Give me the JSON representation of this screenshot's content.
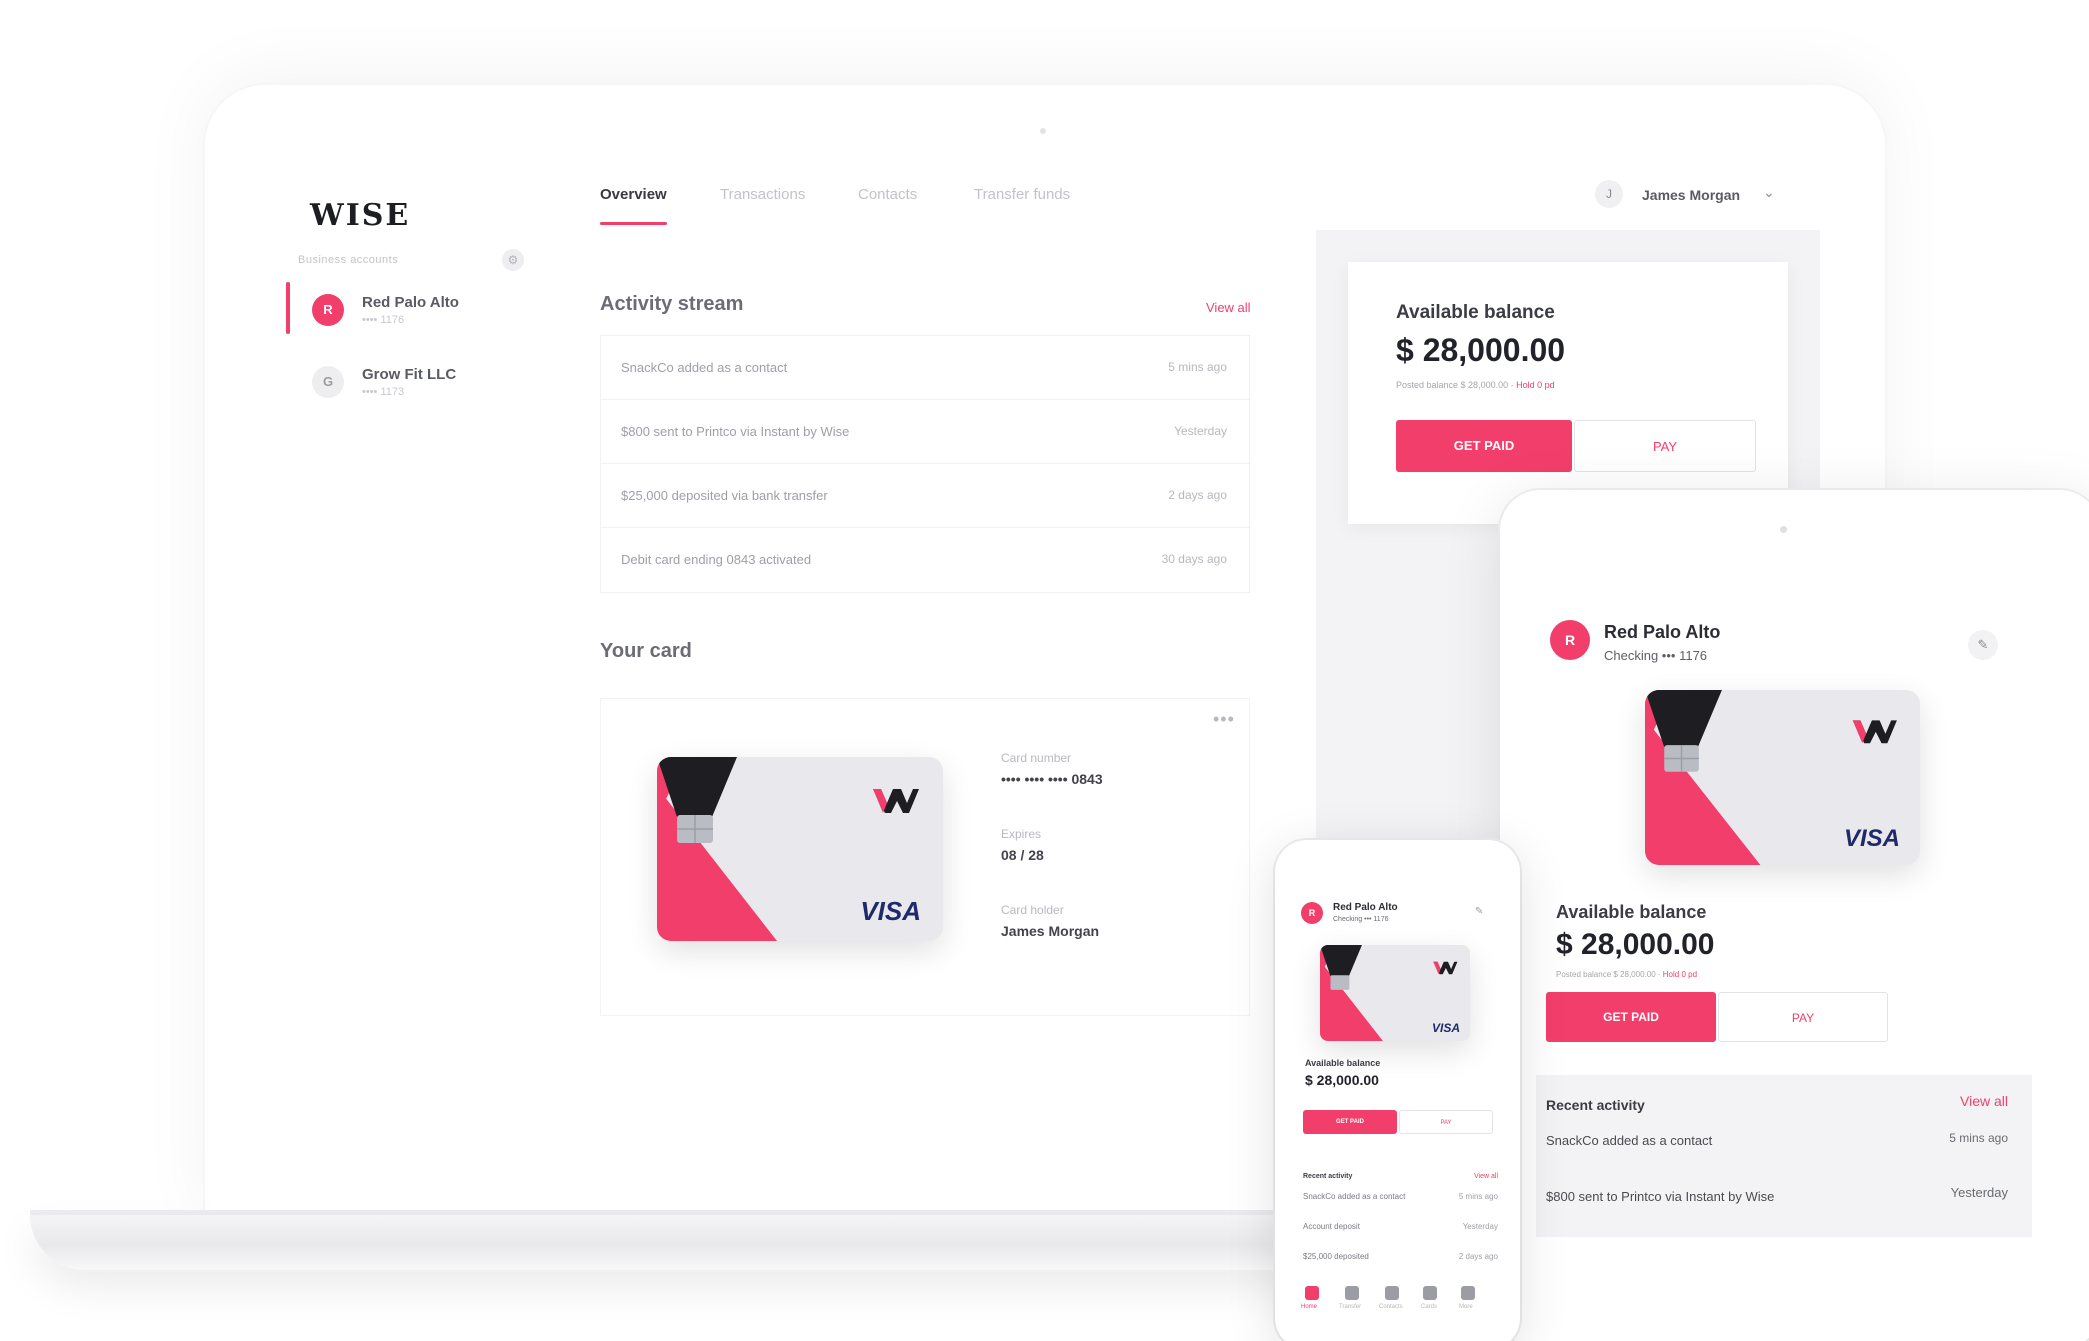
{
  "app": {
    "logo": "WISE"
  },
  "sidebar": {
    "section_label": "Business accounts",
    "accounts": [
      {
        "initial": "R",
        "name": "Red Palo Alto",
        "sub": "•••• 1176"
      },
      {
        "initial": "G",
        "name": "Grow Fit LLC",
        "sub": "•••• 1173"
      }
    ]
  },
  "nav": {
    "tabs": [
      "Overview",
      "Transactions",
      "Contacts",
      "Transfer funds"
    ],
    "user": {
      "initial": "J",
      "name": "James Morgan"
    }
  },
  "activity": {
    "title": "Activity stream",
    "view_all": "View all",
    "items": [
      {
        "text": "SnackCo added as a contact",
        "time": "5 mins ago"
      },
      {
        "text": "$800 sent to Printco via Instant by Wise",
        "time": "Yesterday"
      },
      {
        "text": "$25,000 deposited via bank transfer",
        "time": "2 days ago"
      },
      {
        "text": "Debit card ending 0843 activated",
        "time": "30 days ago"
      }
    ]
  },
  "your_card": {
    "title": "Your card",
    "more": "•••",
    "number_label": "Card number",
    "number": "•••• •••• •••• 0843",
    "expires_label": "Expires",
    "expires": "08 / 28",
    "holder_label": "Card holder",
    "holder": "James Morgan",
    "brand": "VISA"
  },
  "balance": {
    "title": "Available balance",
    "amount": "$ 28,000.00",
    "note_prefix": "Posted balance $ 28,000.00 ·",
    "note_link": "Hold 0 pd",
    "get_paid": "GET PAID",
    "pay": "PAY"
  },
  "tablet": {
    "initial": "R",
    "account_name": "Red Palo Alto",
    "account_sub": "Checking ••• 1176",
    "edit_icon": "pencil-icon",
    "recent_title": "Recent activity",
    "view_all": "View all",
    "recent": [
      {
        "text": "SnackCo added as a contact",
        "time": "5 mins ago"
      },
      {
        "text": "$800 sent to Printco via Instant by Wise",
        "time": "Yesterday"
      }
    ]
  },
  "phone": {
    "initial": "R",
    "account_name": "Red Palo Alto",
    "account_sub": "Checking ••• 1176",
    "recent_title": "Recent activity",
    "view_all": "View all",
    "recent": [
      {
        "text": "SnackCo added as a contact",
        "time": "5 mins ago"
      },
      {
        "text": "Account deposit",
        "time": "Yesterday"
      },
      {
        "text": "$25,000 deposited",
        "time": "2 days ago"
      }
    ],
    "nav": [
      "Home",
      "Transfer",
      "Contacts",
      "Cards",
      "More"
    ]
  },
  "colors": {
    "accent": "#f23e6b",
    "visa": "#1f2a6b",
    "panel_grey": "#f3f3f5"
  }
}
